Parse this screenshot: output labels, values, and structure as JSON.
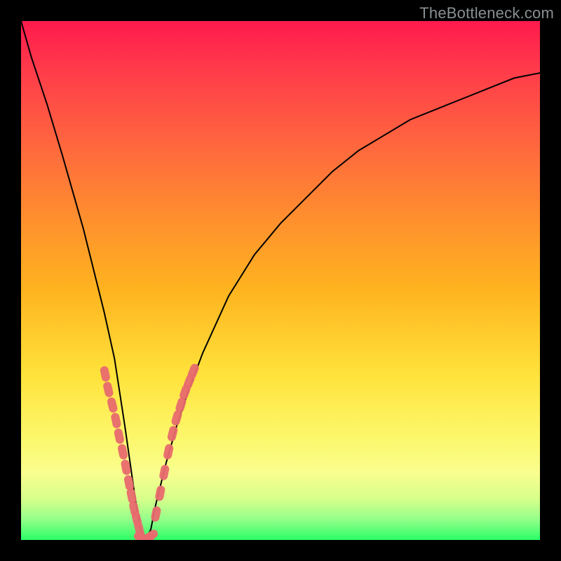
{
  "watermark": "TheBottleneck.com",
  "colors": {
    "frame": "#000000",
    "curve": "#000000",
    "marker": "#e86a6e",
    "gradient_stops": [
      "#ff1a4d",
      "#ff3d4a",
      "#ff6a3d",
      "#ff8f2e",
      "#ffb41f",
      "#ffe23a",
      "#fcf76a",
      "#f9fe8e",
      "#d8ff8a",
      "#94ff8a",
      "#2aff66"
    ]
  },
  "chart_data": {
    "type": "line",
    "title": "",
    "xlabel": "",
    "ylabel": "",
    "xlim": [
      0,
      100
    ],
    "ylim": [
      0,
      100
    ],
    "note": "Bottleneck-style V curve. y ≈ 100 at x=0, drops to ~0 near x≈23 (minimum), rises asymptotically toward ~90 as x→100. Values estimated from pixel positions.",
    "x": [
      0,
      2,
      5,
      8,
      10,
      12,
      14,
      16,
      18,
      20,
      21,
      22,
      23,
      24,
      25,
      26,
      28,
      30,
      32,
      35,
      40,
      45,
      50,
      55,
      60,
      65,
      70,
      75,
      80,
      85,
      90,
      95,
      100
    ],
    "y": [
      100,
      93,
      84,
      74,
      67,
      60,
      52,
      44,
      35,
      22,
      15,
      8,
      2,
      0,
      2,
      7,
      15,
      22,
      28,
      36,
      47,
      55,
      61,
      66,
      71,
      75,
      78,
      81,
      83,
      85,
      87,
      89,
      90
    ],
    "series": [
      {
        "name": "markers-left-branch",
        "x": [
          16.2,
          16.8,
          17.6,
          18.3,
          18.9,
          19.6,
          20.2,
          20.8,
          21.3,
          21.8,
          22.3,
          22.8
        ],
        "y": [
          32,
          29,
          26,
          23,
          20,
          17,
          14,
          11,
          8.5,
          6,
          4,
          2
        ]
      },
      {
        "name": "markers-bottom",
        "x": [
          23.2,
          23.8,
          24.4,
          25.0
        ],
        "y": [
          0.5,
          0.3,
          0.4,
          0.8
        ]
      },
      {
        "name": "markers-right-branch",
        "x": [
          26.0,
          26.8,
          27.6,
          28.4,
          29.2,
          30.0,
          30.8,
          31.6,
          32.4,
          33.2
        ],
        "y": [
          5,
          9,
          13,
          17,
          20.5,
          23.5,
          26,
          28.5,
          30.5,
          32.5
        ]
      }
    ]
  }
}
